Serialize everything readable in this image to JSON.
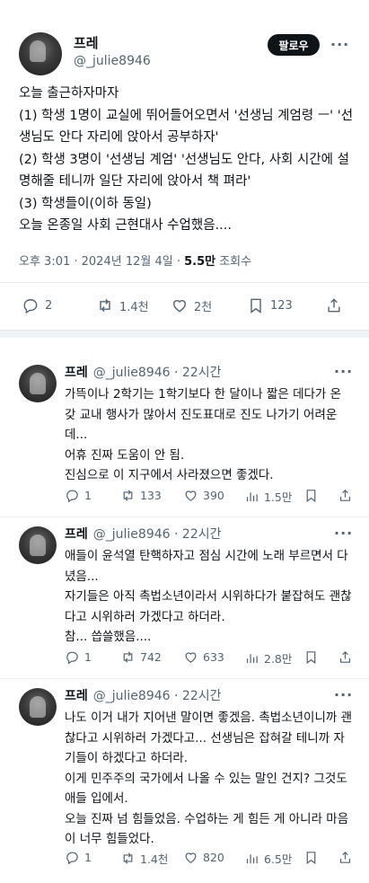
{
  "post": {
    "author_name": "프레",
    "author_handle": "@_julie8946",
    "follow_label": "팔로우",
    "text": "오늘 출근하자마자\n(1) 학생 1명이 교실에 뛰어들어오면서 '선생님 계엄령 ㅡ' '선생님도 안다 자리에 앉아서 공부하자'\n(2) 학생 3명이 '선생님 계엄' '선생님도 안다, 사회 시간에 설명해줄 테니까 일단 자리에 앉아서 책 펴라'\n(3) 학생들이(이하 동일)\n오늘 온종일 사회 근현대사 수업했음....",
    "timestamp": "오후 3:01 · 2024년 12월 4일 · ",
    "views_count": "5.5만",
    "views_label": " 조회수",
    "replies": "2",
    "reposts": "1.4천",
    "likes": "2천",
    "bookmarks": "123"
  },
  "replies": [
    {
      "name": "프레",
      "handle": "@_julie8946",
      "time": " · 22시간",
      "text": "가뜩이나 2학기는 1학기보다 한 달이나 짧은 데다가 온갖 교내 행사가 많아서 진도표대로 진도 나가기 어려운데...\n어휴 진짜 도움이 안 됨.\n진심으로 이 지구에서 사라졌으면 좋겠다.",
      "replies": "1",
      "reposts": "133",
      "likes": "390",
      "views": "1.5만"
    },
    {
      "name": "프레",
      "handle": "@_julie8946",
      "time": " · 22시간",
      "text": "애들이 윤석열 탄핵하자고 점심 시간에 노래 부르면서 다녔음...\n자기들은 아직 촉법소년이라서 시위하다가 붙잡혀도 괜찮다고 시위하러 가겠다고 하더라.\n참... 씁쓸했음....",
      "replies": "1",
      "reposts": "742",
      "likes": "633",
      "views": "2.8만"
    },
    {
      "name": "프레",
      "handle": "@_julie8946",
      "time": " · 22시간",
      "text": "나도 이거 내가 지어낸 말이면 좋겠음. 촉법소년이니까 괜찮다고 시위하러 가겠다고... 선생님은 잡혀갈 테니까 자기들이 하겠다고 하더라.\n이게 민주주의 국가에서 나올 수 있는 말인 건지? 그것도 애들 입에서.\n오늘 진짜 넘 힘들었음. 수업하는 게 힘든 게 아니라 마음이 너무 힘들었다.",
      "replies": "1",
      "reposts": "1.4천",
      "likes": "820",
      "views": "6.5만"
    }
  ]
}
